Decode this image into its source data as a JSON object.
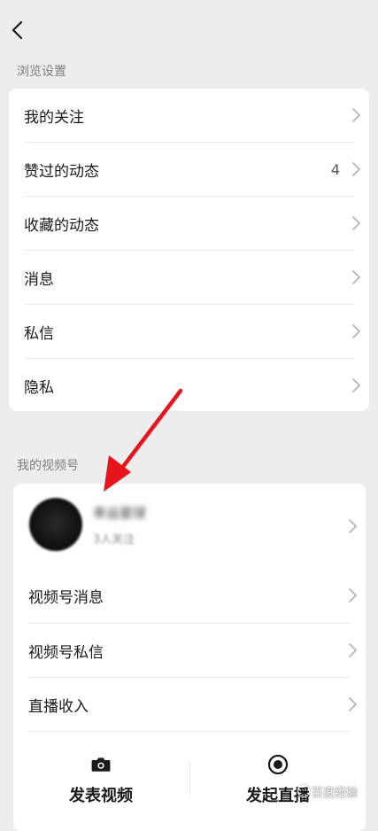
{
  "nav": {
    "back_icon": "chevron-left-icon"
  },
  "browse_settings": {
    "title": "浏览设置",
    "items": [
      {
        "label": "我的关注",
        "count": ""
      },
      {
        "label": "赞过的动态",
        "count": "4"
      },
      {
        "label": "收藏的动态",
        "count": ""
      },
      {
        "label": "消息",
        "count": ""
      },
      {
        "label": "私信",
        "count": ""
      },
      {
        "label": "隐私",
        "count": ""
      }
    ]
  },
  "my_channel": {
    "title": "我的视频号",
    "profile": {
      "name": "幸运星球",
      "followers": "3人关注"
    },
    "items": [
      {
        "label": "视频号消息"
      },
      {
        "label": "视频号私信"
      },
      {
        "label": "直播收入"
      }
    ],
    "actions": [
      {
        "label": "发表视频",
        "icon": "camera-icon"
      },
      {
        "label": "发起直播",
        "icon": "live-record-icon"
      }
    ]
  },
  "annotation": {
    "color": "#e8141b"
  },
  "watermark": {
    "text": "百度经验"
  }
}
